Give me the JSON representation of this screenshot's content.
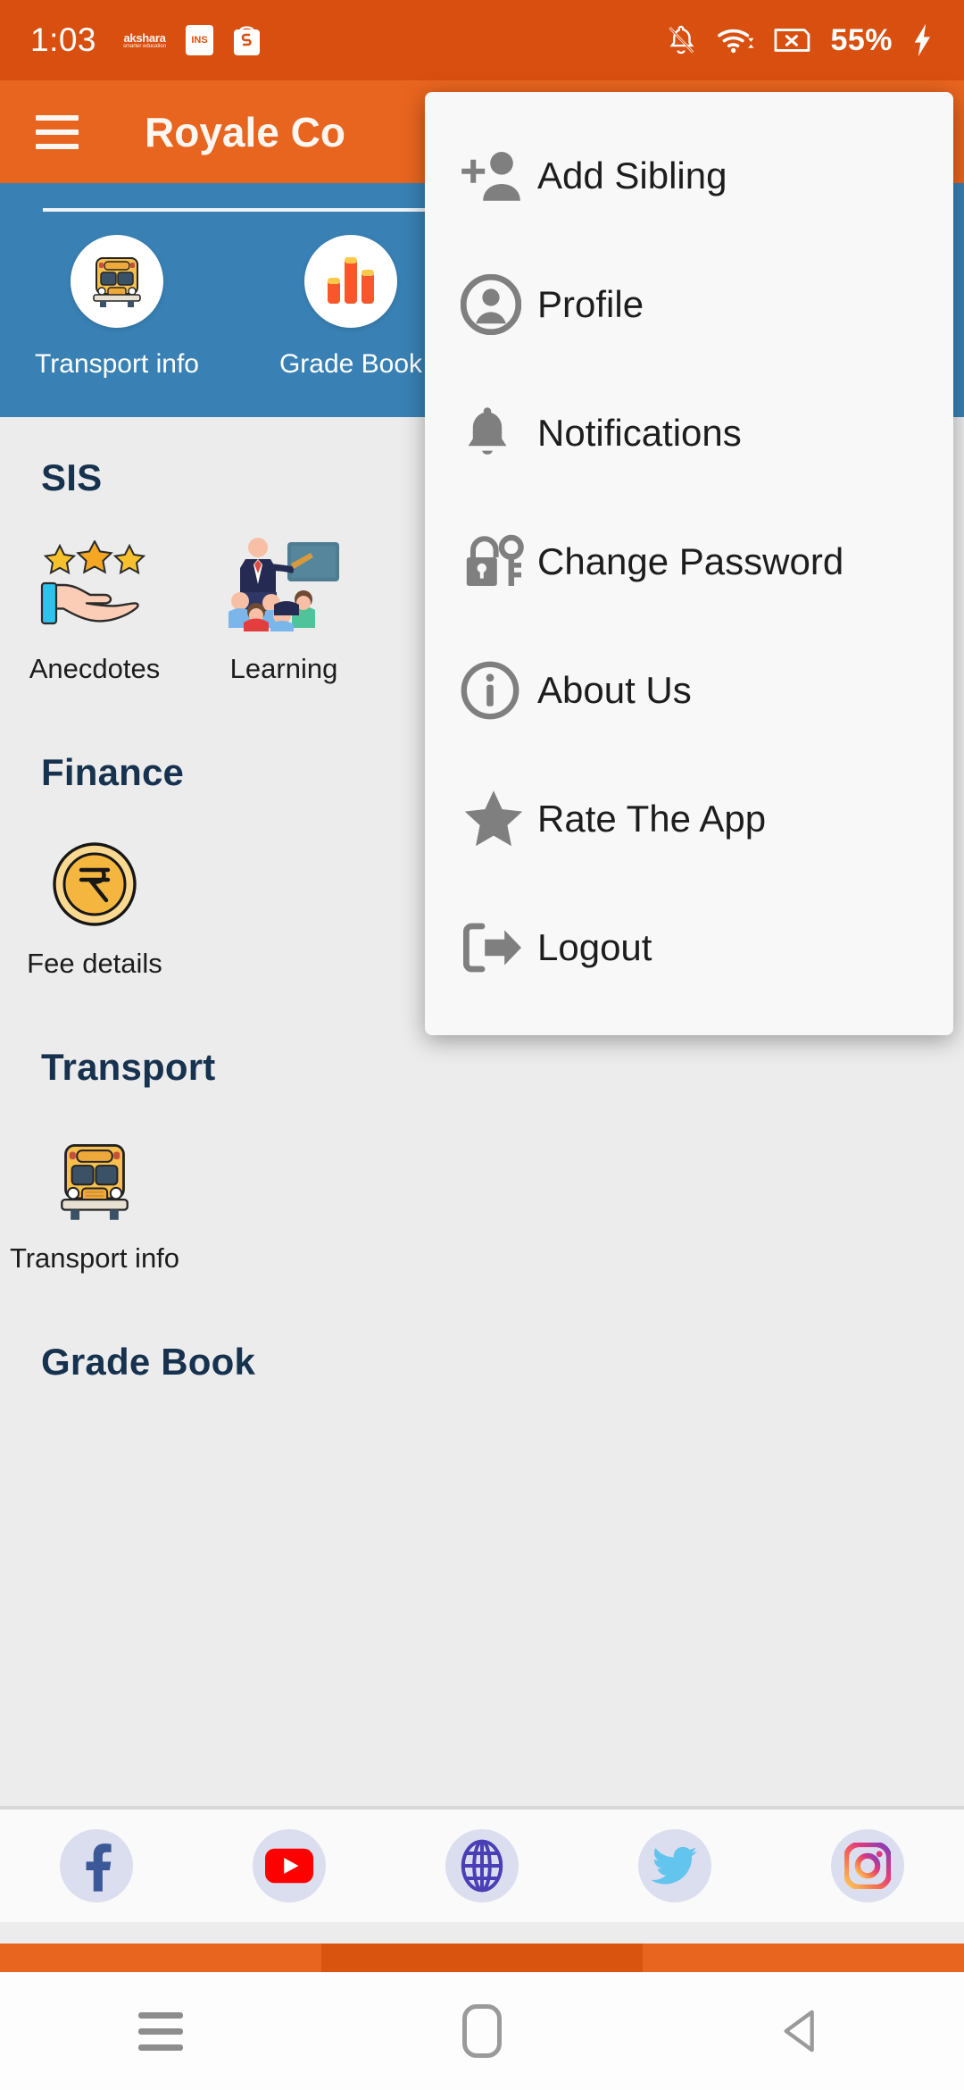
{
  "status_bar": {
    "time": "1:03",
    "notification_icons": [
      "akshara-app-logo",
      "ins-app-logo",
      "shopping-app-logo"
    ],
    "app_logo_text": "akshara",
    "app_logo_subtext": "smarter education",
    "ins_logo_text": "INS",
    "right_icons": [
      "bell-off-icon",
      "wifi-icon",
      "sim-no-signal-icon",
      "charging-bolt-icon"
    ],
    "battery_label": "55%"
  },
  "app_bar": {
    "menu_icon": "hamburger-icon",
    "title": "Royale Co"
  },
  "overflow_menu": {
    "items": [
      {
        "label": "Add Sibling",
        "icon": "person-add-icon"
      },
      {
        "label": "Profile",
        "icon": "account-circle-icon"
      },
      {
        "label": "Notifications",
        "icon": "bell-icon"
      },
      {
        "label": "Change Password",
        "icon": "lock-key-icon"
      },
      {
        "label": "About Us",
        "icon": "info-circle-icon"
      },
      {
        "label": "Rate The App",
        "icon": "star-icon"
      },
      {
        "label": "Logout",
        "icon": "logout-arrow-icon"
      }
    ]
  },
  "banner": {
    "background_color": "#3981b4",
    "quick_links": [
      {
        "label": "Transport info",
        "icon": "school-bus-icon"
      },
      {
        "label": "Grade Book",
        "icon": "bar-chart-icon"
      }
    ]
  },
  "sections": [
    {
      "title": "SIS",
      "tiles": [
        {
          "label": "Anecdotes",
          "icon": "hand-with-stars-icon"
        },
        {
          "label": "Learning",
          "icon": "teacher-classroom-icon"
        }
      ]
    },
    {
      "title": "Finance",
      "tiles": [
        {
          "label": "Fee details",
          "icon": "rupee-coin-icon"
        }
      ]
    },
    {
      "title": "Transport",
      "tiles": [
        {
          "label": "Transport info",
          "icon": "school-bus-icon"
        }
      ]
    },
    {
      "title": "Grade Book",
      "tiles": []
    }
  ],
  "social_bar": {
    "items": [
      {
        "name": "facebook-icon",
        "color": "#3b5998"
      },
      {
        "name": "youtube-icon",
        "color": "#ff0000"
      },
      {
        "name": "website-icon",
        "color": "#4a3fb5"
      },
      {
        "name": "twitter-icon",
        "color": "#63c4ee"
      },
      {
        "name": "instagram-icon",
        "color": "#e1306c"
      }
    ],
    "circle_color": "#dbdeef"
  },
  "system_nav": {
    "buttons": [
      "recents-icon",
      "home-icon",
      "back-icon"
    ]
  },
  "theme": {
    "status_bar_orange": "#d94f10",
    "app_bar_orange": "#e8651f",
    "banner_blue": "#3981b4",
    "heading_navy": "#17324f",
    "page_background": "#ececec"
  }
}
